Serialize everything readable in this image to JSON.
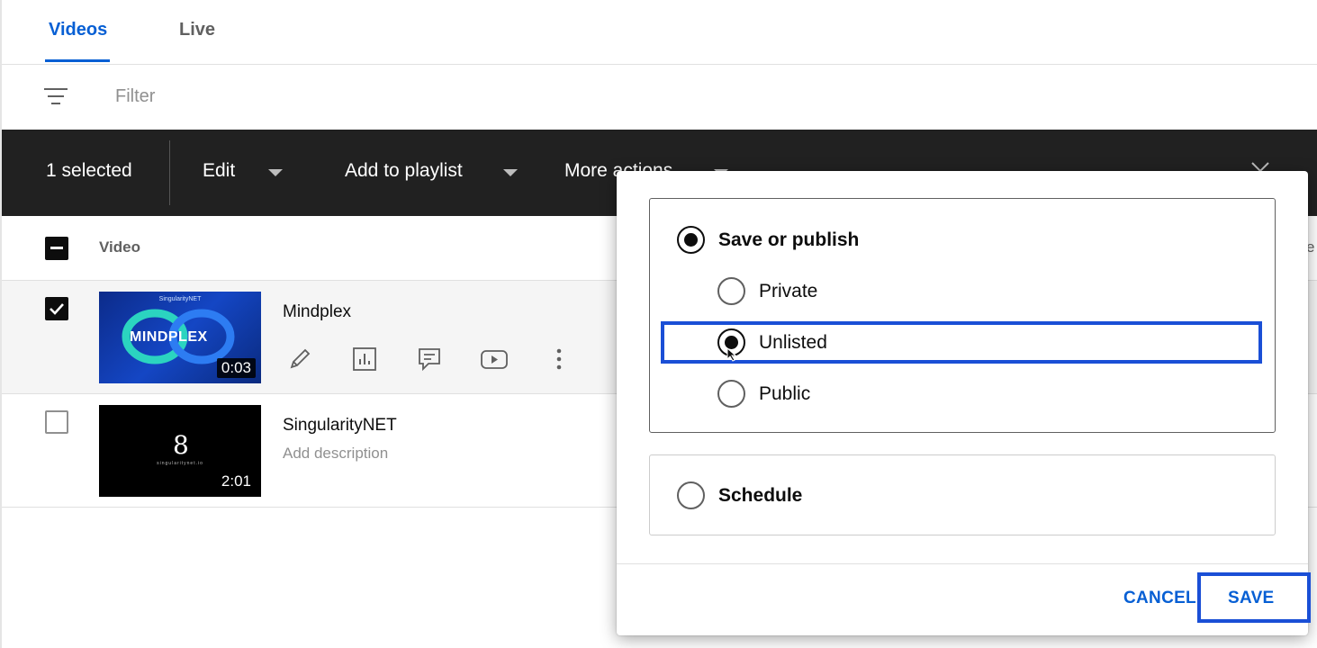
{
  "tabs": {
    "videos": "Videos",
    "live": "Live"
  },
  "filter": {
    "label": "Filter"
  },
  "selection_bar": {
    "count": "1 selected",
    "edit": "Edit",
    "add_to_playlist": "Add to playlist",
    "more_actions": "More actions"
  },
  "table": {
    "header_video": "Video",
    "header_right_partial": "e",
    "rows": [
      {
        "title": "Mindplex",
        "duration": "0:03",
        "thumb_brand": "SingularityNET",
        "thumb_text": "MINDPLEX",
        "checked": true
      },
      {
        "title": "SingularityNET",
        "description": "Add description",
        "duration": "2:01",
        "thumb_glyph": "8",
        "thumb_sub": "singularitynet.io",
        "checked": false
      }
    ]
  },
  "visibility_dialog": {
    "save_or_publish": "Save or publish",
    "options": [
      "Private",
      "Unlisted",
      "Public"
    ],
    "selected": "Unlisted",
    "schedule": "Schedule",
    "cancel": "CANCEL",
    "save": "SAVE"
  },
  "colors": {
    "accent": "#065fd4",
    "highlight": "#1a4fd6",
    "bar": "#212121"
  }
}
